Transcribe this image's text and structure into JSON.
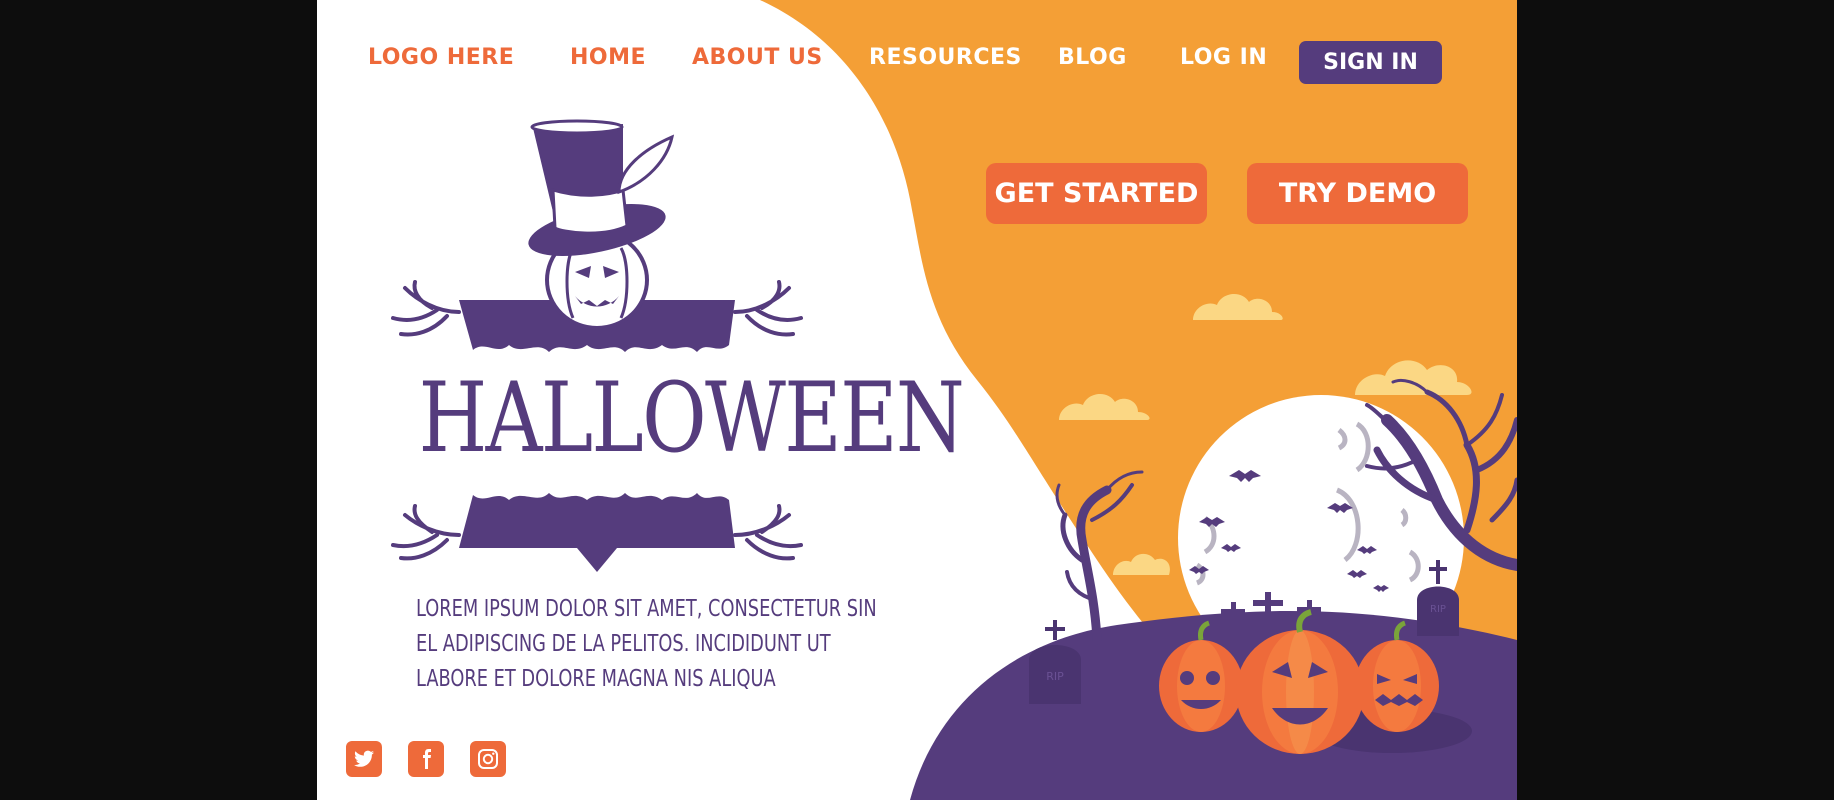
{
  "nav": {
    "logo": "LOGO HERE",
    "items": [
      "HOME",
      "ABOUT US",
      "RESOURCES",
      "BLOG",
      "LOG IN"
    ],
    "signin": "SIGN IN"
  },
  "hero": {
    "title": "HALLOWEEN",
    "description": "LOREM IPSUM DOLOR SIT AMET, CONSECTETUR SIN EL ADIPISCING DE LA PELITOS. INCIDIDUNT UT LABORE ET DOLORE MAGNA NIS ALIQUA"
  },
  "cta": {
    "get_started": "GET STARTED",
    "try_demo": "TRY DEMO"
  },
  "social": [
    "twitter-icon",
    "facebook-icon",
    "instagram-icon"
  ],
  "tombstone_text": "RIP",
  "colors": {
    "orange": "#f49f36",
    "coral": "#ee6a3a",
    "purple": "#553c7d",
    "cloud": "#fbd784",
    "moon": "#ffffff"
  }
}
